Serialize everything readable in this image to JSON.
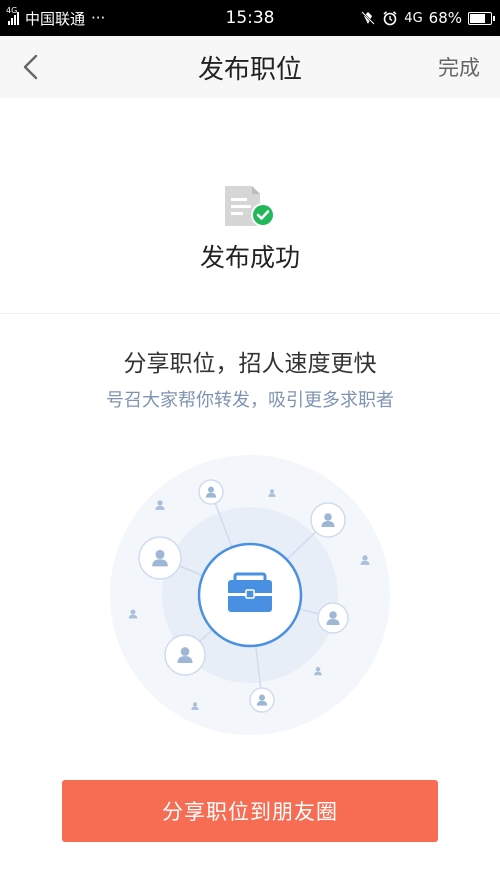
{
  "status_bar": {
    "network_small": "4G",
    "carrier": "中国联通",
    "overflow": "···",
    "time": "15:38",
    "network_type": "4G",
    "battery": "68%",
    "battery_level": 0.68
  },
  "nav": {
    "back_icon": "chevron-left-icon",
    "title": "发布职位",
    "done_label": "完成"
  },
  "success": {
    "icon": "document-check-icon",
    "text": "发布成功"
  },
  "share": {
    "title": "分享职位，招人速度更快",
    "subtitle": "号召大家帮你转发，吸引更多求职者",
    "illustration_icons": [
      "briefcase-icon",
      "person-icon"
    ],
    "button_label": "分享职位到朋友圈"
  },
  "colors": {
    "accent": "#f76d53",
    "success_green": "#22b85a",
    "illustration_blue": "#4a90e2",
    "subtitle": "#7f93b2"
  }
}
